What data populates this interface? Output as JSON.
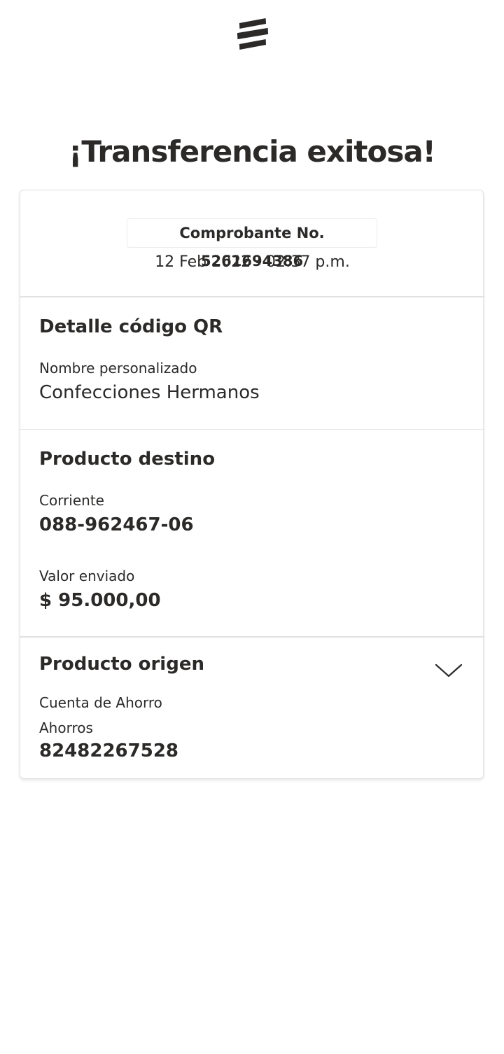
{
  "header": {
    "logo_icon": "bancolombia-stripes-logo"
  },
  "page": {
    "title": "¡Transferencia exitosa!"
  },
  "receipt": {
    "comprobante": "Comprobante No. 5261694386",
    "datetime": "12 Feb 2022 - 02:37 p.m."
  },
  "qr_detail": {
    "title": "Detalle código QR",
    "name_label": "Nombre personalizado",
    "name_value": "Confecciones Hermanos"
  },
  "destination": {
    "title": "Producto destino",
    "account_type": "Corriente",
    "account_number": "088-962467-06",
    "amount_label": "Valor enviado",
    "amount_value": "$ 95.000,00"
  },
  "origin": {
    "title": "Producto origen",
    "expand_icon": "chevron-down-icon",
    "account_name": "Cuenta de Ahorro",
    "account_type": "Ahorros",
    "account_number": "82482267528"
  },
  "colors": {
    "text": "#2c2a29",
    "divider": "#e6e6e6",
    "background": "#ffffff"
  }
}
